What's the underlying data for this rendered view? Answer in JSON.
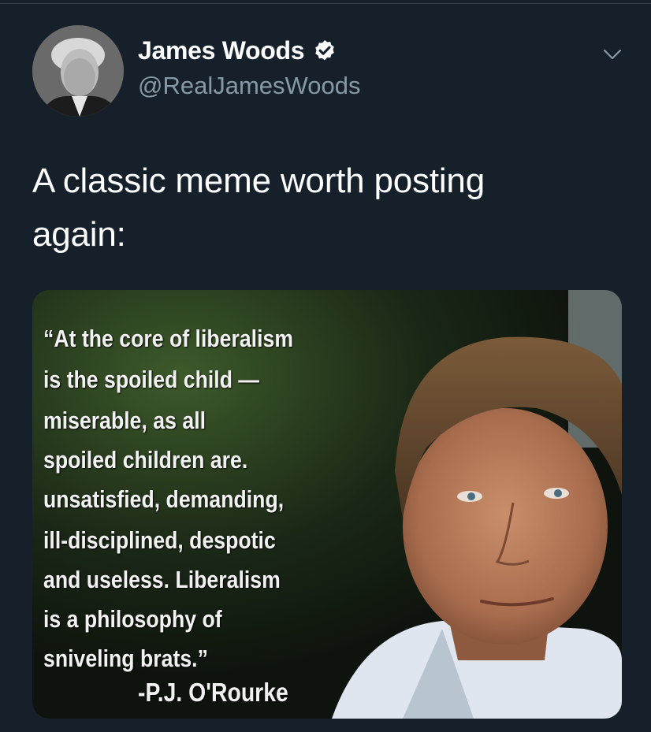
{
  "tweet": {
    "display_name": "James Woods",
    "handle": "@RealJamesWoods",
    "text_line1": "A classic meme worth posting",
    "text_line2": "again:"
  },
  "media": {
    "quote_lines": [
      "“At the core of liberalism",
      "is the spoiled child —",
      "miserable, as all",
      "spoiled children are.",
      "unsatisfied, demanding,",
      "ill-disciplined, despotic",
      "and useless. Liberalism",
      "is a philosophy of",
      "sniveling brats.”"
    ],
    "attribution": "-P.J. O'Rourke"
  },
  "icons": {
    "verified": "verified-badge-icon",
    "menu": "chevron-down-icon"
  },
  "colors": {
    "background": "#15202b",
    "handle": "#8899a6",
    "divider": "#38444d"
  }
}
